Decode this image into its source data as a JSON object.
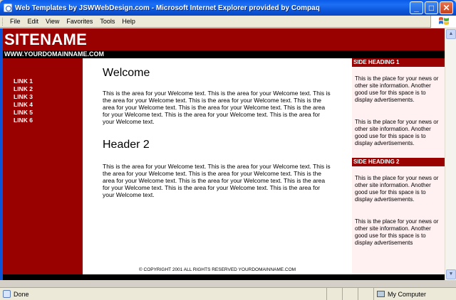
{
  "window": {
    "title": "Web Templates by JSWWebDesign.com - Microsoft Internet Explorer provided by Compaq",
    "minimize": "_",
    "maximize": "□",
    "close": "✕"
  },
  "menu": {
    "items": [
      "File",
      "Edit",
      "View",
      "Favorites",
      "Tools",
      "Help"
    ]
  },
  "page": {
    "site_name": "SITENAME",
    "domain": "WWW.YOURDOMAINNAME.COM",
    "nav_links": [
      "LINK 1",
      "LINK 2",
      "LINK 3",
      "LINK 4",
      "LINK 5",
      "LINK 6"
    ],
    "welcome_heading": "Welcome",
    "welcome_text": "This is the area for your Welcome text. This is the area for your Welcome text. This is the area for your Welcome text. This is the area for your Welcome text. This is the area for your Welcome text. This is the area for your Welcome text. This is the area for your Welcome text. This is the area for your Welcome text. This is the area for your Welcome text.",
    "header2_heading": "Header 2",
    "header2_text": "This is the area for your Welcome text. This is the area for your Welcome text. This is the area for your Welcome text. This is the area for your Welcome text. This is the area for your Welcome text. This is the area for your Welcome text. This is the area for your Welcome text. This is the area for your Welcome text. This is the area for your Welcome text.",
    "copyright": "© COPYRIGHT 2001 ALL RIGHTS RESERVED YOURDOMAINNAME.COM",
    "side_heading_1": "SIDE HEADING 1",
    "side_text_1a": "This is the place for your news or other site information. Another good use for this space is to display advertisements.",
    "side_text_1b": "This is the place for your news or other site information. Another good use for this space is to display advertisements.",
    "side_heading_2": "SIDE HEADING 2",
    "side_text_2a": "This is the place for your news or other site information. Another good use for this space is to display advertisements.",
    "side_text_2b": "This is the place for your news or other site information. Another good use for this space is to display advertisements"
  },
  "status": {
    "text": "Done",
    "zone": "My Computer"
  },
  "colors": {
    "brand": "#990000",
    "sidebar_bg": "#fff0f2",
    "titlebar": "#0a5ce8"
  }
}
